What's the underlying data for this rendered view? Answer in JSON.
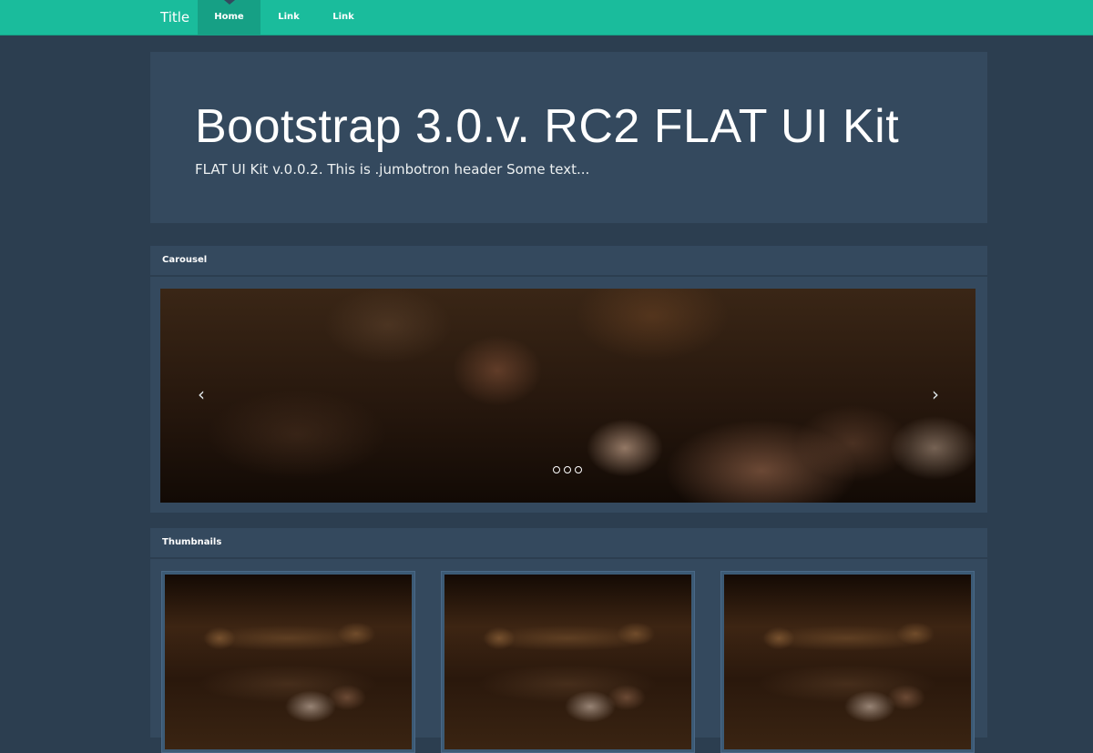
{
  "navbar": {
    "brand": "Title",
    "items": [
      {
        "label": "Home",
        "active": true
      },
      {
        "label": "Link",
        "active": false
      },
      {
        "label": "Link",
        "active": false
      }
    ]
  },
  "jumbotron": {
    "title": "Bootstrap 3.0.v. RC2 FLAT UI Kit",
    "subtitle": "FLAT UI Kit v.0.0.2. This is .jumbotron header Some text..."
  },
  "carousel_panel": {
    "heading": "Carousel",
    "prev_icon": "‹",
    "next_icon": "›",
    "slide_count": 3
  },
  "thumbnails_panel": {
    "heading": "Thumbnails",
    "count": 3
  },
  "colors": {
    "navbar": "#1abc9c",
    "navbar_active": "#16a085",
    "background": "#2c3e50",
    "panel": "#34495e"
  }
}
